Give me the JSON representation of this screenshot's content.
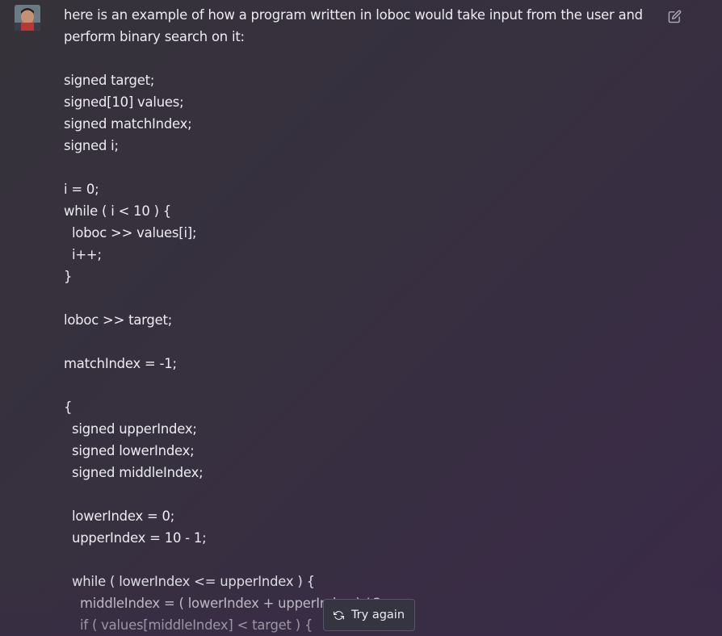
{
  "message": {
    "intro": "here is an example of how a program written in loboc would take input from the user and perform binary search on it:",
    "code_lines": [
      "",
      "signed target;",
      "signed[10] values;",
      "signed matchIndex;",
      "signed i;",
      "",
      "i = 0;",
      "while ( i < 10 ) {",
      "  loboc >> values[i];",
      "  i++;",
      "}",
      "",
      "loboc >> target;",
      "",
      "matchIndex = -1;",
      "",
      "{",
      "  signed upperIndex;",
      "  signed lowerIndex;",
      "  signed middleIndex;",
      "",
      "  lowerIndex = 0;",
      "  upperIndex = 10 - 1;",
      "",
      "  while ( lowerIndex <= upperIndex ) {",
      "    middleIndex = ( lowerIndex + upperIndex ) / 2;",
      "    if ( values[middleIndex] < target ) {"
    ]
  },
  "actions": {
    "try_again_label": "Try again",
    "try_again_icon": "refresh-icon",
    "edit_icon": "edit-icon"
  },
  "colors": {
    "text": "#ececf1",
    "button_bg": "#343541",
    "button_border": "#565869"
  }
}
